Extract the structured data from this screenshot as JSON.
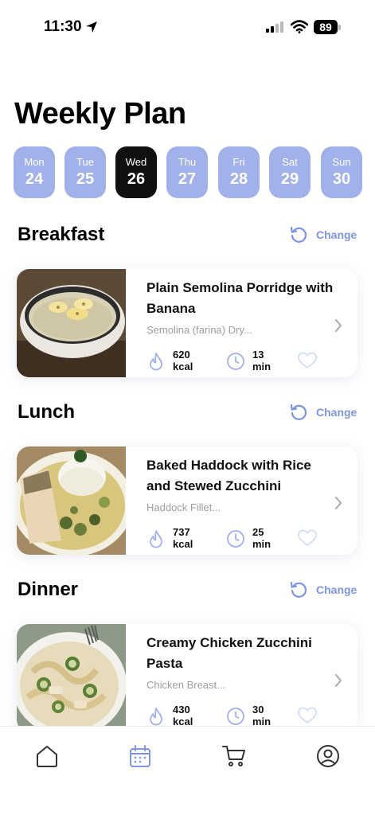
{
  "status": {
    "time": "11:30",
    "battery": "89"
  },
  "title": "Weekly Plan",
  "days": [
    {
      "name": "Mon",
      "num": "24",
      "active": false
    },
    {
      "name": "Tue",
      "num": "25",
      "active": false
    },
    {
      "name": "Wed",
      "num": "26",
      "active": true
    },
    {
      "name": "Thu",
      "num": "27",
      "active": false
    },
    {
      "name": "Fri",
      "num": "28",
      "active": false
    },
    {
      "name": "Sat",
      "num": "29",
      "active": false
    },
    {
      "name": "Sun",
      "num": "30",
      "active": false
    }
  ],
  "change_label": "Change",
  "meals": [
    {
      "section": "Breakfast",
      "title": "Plain Semolina Porridge with Banana",
      "ingredients": "Semolina (farina) Dry...",
      "kcal": "620",
      "kcal_unit": "kcal",
      "time": "13",
      "time_unit": "min"
    },
    {
      "section": "Lunch",
      "title": "Baked Haddock with Rice and Stewed Zucchini",
      "ingredients": "Haddock Fillet...",
      "kcal": "737",
      "kcal_unit": "kcal",
      "time": "25",
      "time_unit": "min"
    },
    {
      "section": "Dinner",
      "title": "Creamy Chicken Zucchini Pasta",
      "ingredients": "Chicken Breast...",
      "kcal": "430",
      "kcal_unit": "kcal",
      "time": "30",
      "time_unit": "min"
    }
  ],
  "colors": {
    "accent": "#7f95dd",
    "day_bg": "#a3b1ea",
    "active_day_bg": "#111111"
  },
  "tabs": [
    {
      "icon": "home-icon",
      "active": false
    },
    {
      "icon": "calendar-icon",
      "active": true
    },
    {
      "icon": "cart-icon",
      "active": false
    },
    {
      "icon": "profile-icon",
      "active": false
    }
  ]
}
